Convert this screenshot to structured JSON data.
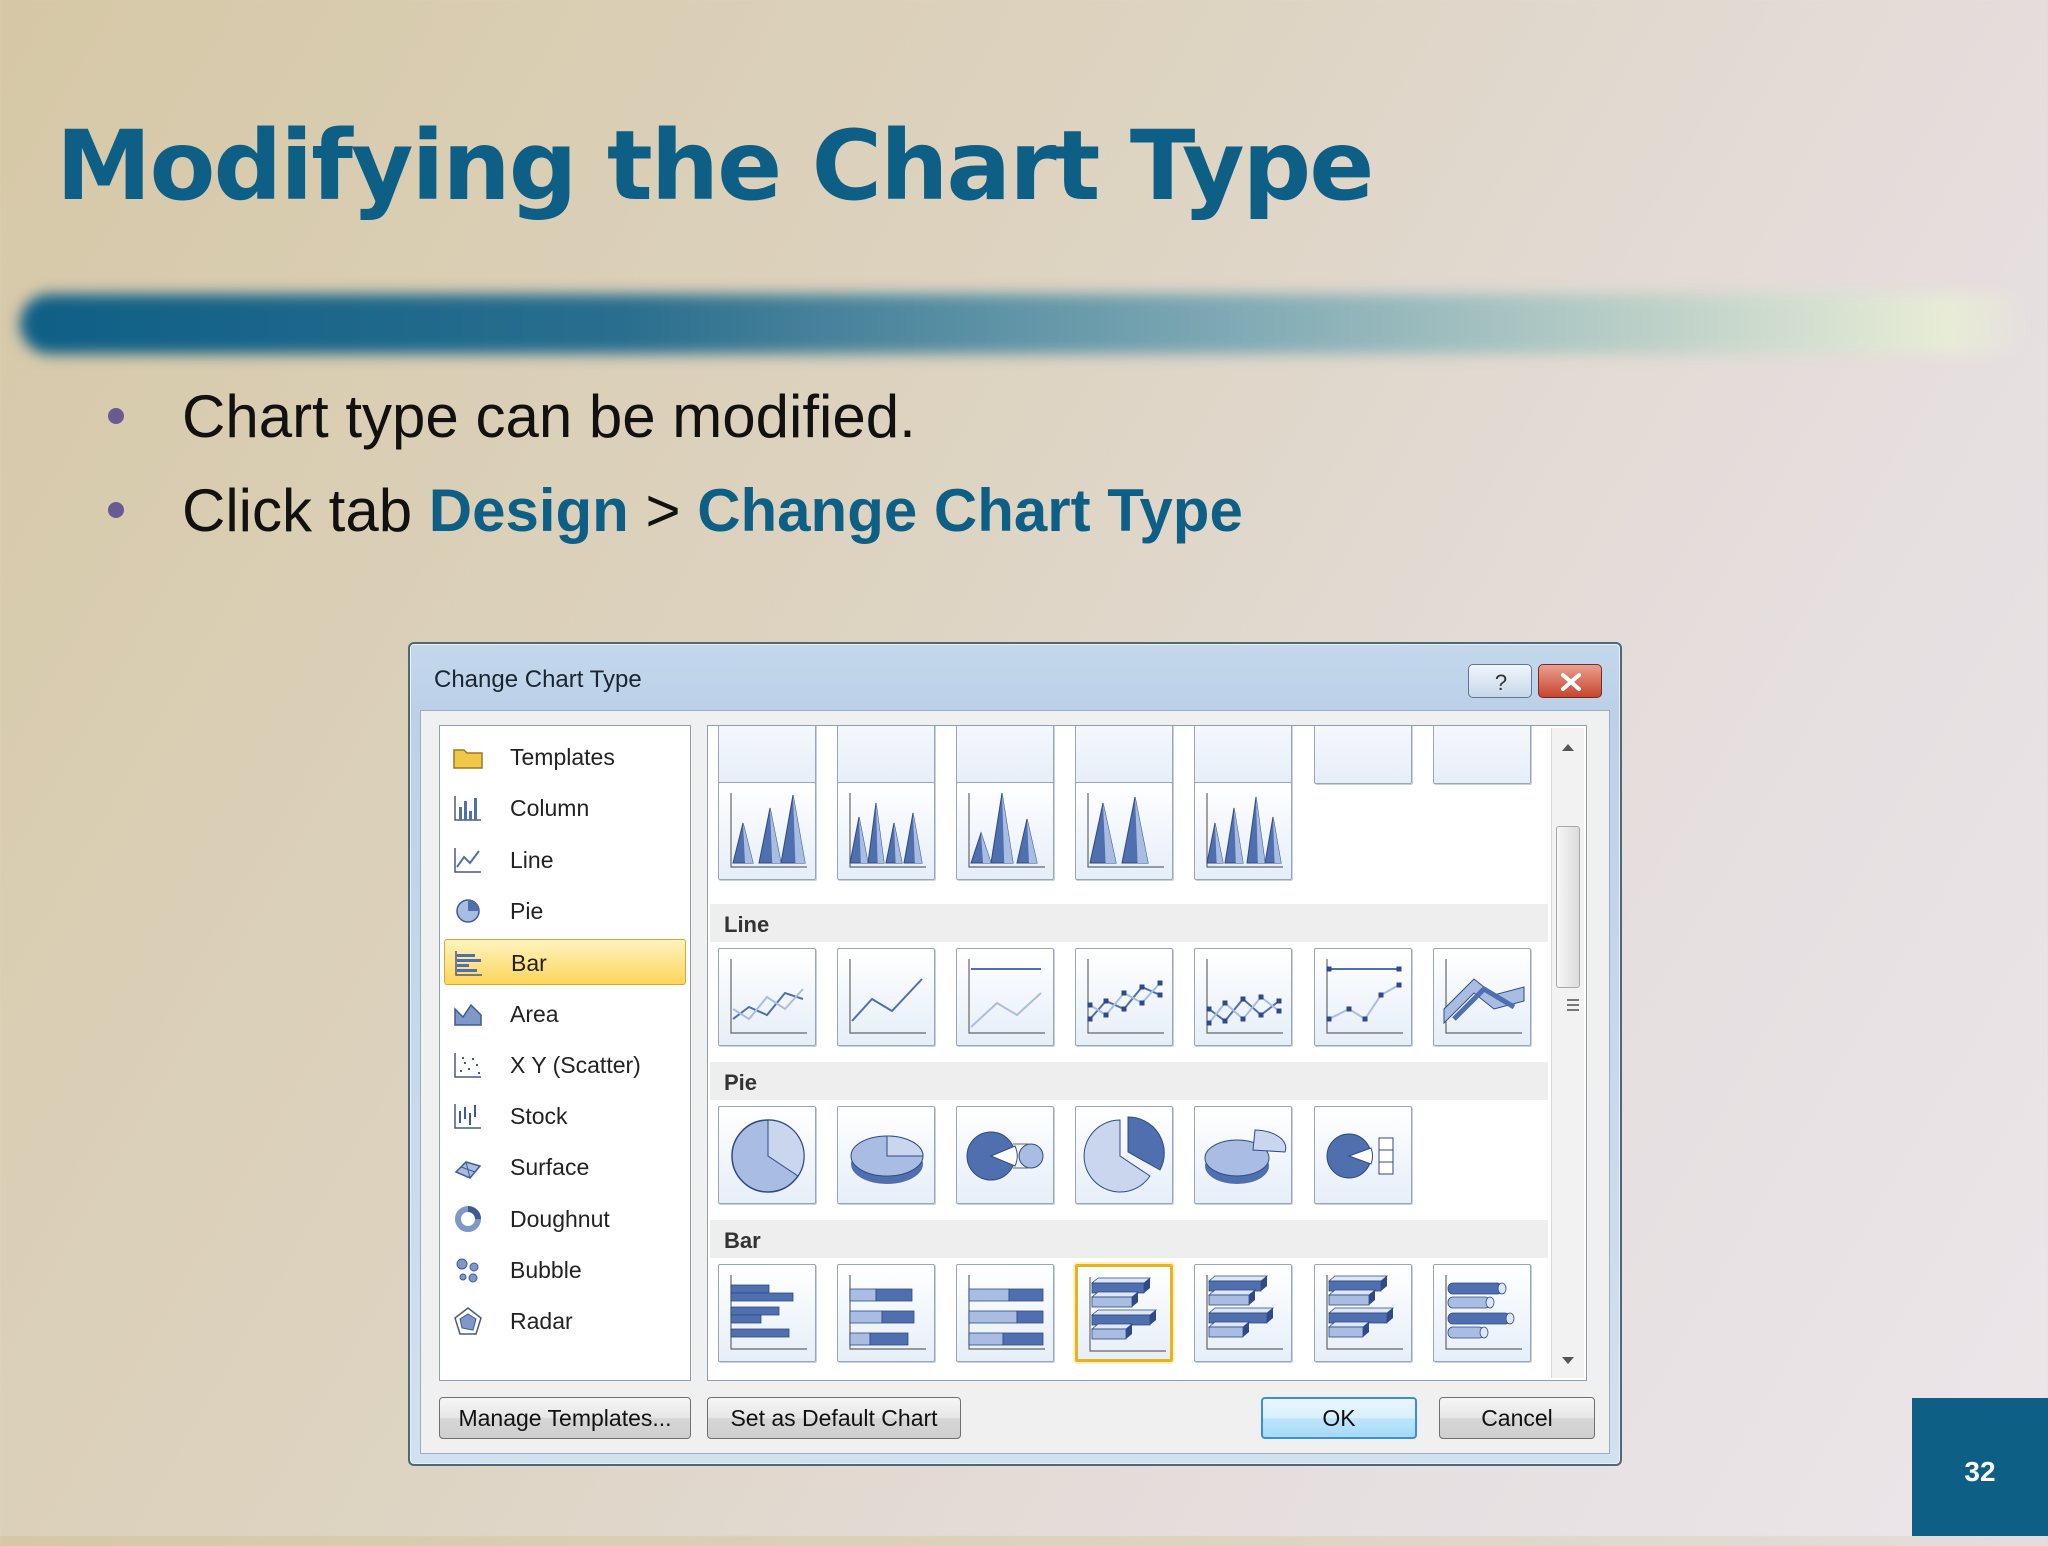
{
  "slide": {
    "title": "Modifying the Chart Type",
    "bullets": [
      {
        "text": "Chart type can be modified."
      },
      {
        "prefix": "Click tab ",
        "tab": "Design",
        "sep": " > ",
        "command": "Change Chart Type"
      }
    ],
    "page_number": "32"
  },
  "dialog": {
    "title": "Change Chart Type",
    "help_glyph": "?",
    "close_glyph": "✕",
    "categories": [
      {
        "label": "Templates",
        "icon": "folder-icon"
      },
      {
        "label": "Column",
        "icon": "column-chart-icon"
      },
      {
        "label": "Line",
        "icon": "line-chart-icon"
      },
      {
        "label": "Pie",
        "icon": "pie-chart-icon"
      },
      {
        "label": "Bar",
        "icon": "bar-chart-icon",
        "selected": true
      },
      {
        "label": "Area",
        "icon": "area-chart-icon"
      },
      {
        "label": "X Y (Scatter)",
        "icon": "scatter-chart-icon"
      },
      {
        "label": "Stock",
        "icon": "stock-chart-icon"
      },
      {
        "label": "Surface",
        "icon": "surface-chart-icon"
      },
      {
        "label": "Doughnut",
        "icon": "doughnut-chart-icon"
      },
      {
        "label": "Bubble",
        "icon": "bubble-chart-icon"
      },
      {
        "label": "Radar",
        "icon": "radar-chart-icon"
      }
    ],
    "gallery": {
      "sections": [
        {
          "heading": "Line"
        },
        {
          "heading": "Pie"
        },
        {
          "heading": "Bar"
        }
      ],
      "selected_subtype": "clustered-bar-3d"
    },
    "buttons": {
      "manage_templates": "Manage Templates...",
      "set_default": "Set as Default Chart",
      "ok": "OK",
      "cancel": "Cancel"
    },
    "colors": {
      "accent": "#0e5f86",
      "selection": "#fcd55a",
      "chart_blue": "#4f6fae"
    }
  }
}
